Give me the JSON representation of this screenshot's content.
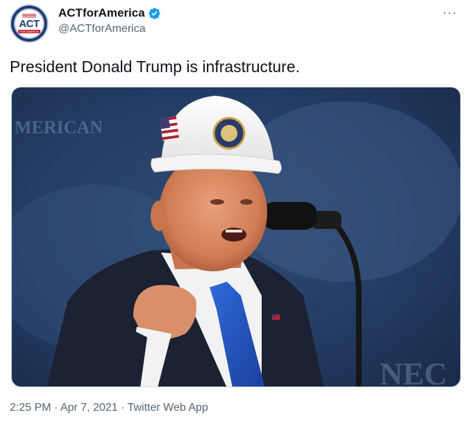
{
  "author": {
    "display_name": "ACTforAmerica",
    "handle": "@ACTforAmerica",
    "verified": true,
    "avatar_text": "ACT",
    "avatar_subtext": "FOR AMERICA"
  },
  "tweet": {
    "text": "President Donald Trump is infrastructure.",
    "time": "2:25 PM",
    "separator": "·",
    "date": "Apr 7, 2021",
    "source": "Twitter Web App"
  },
  "menu": {
    "more_label": "···"
  },
  "media": {
    "description_icon": "photo",
    "background_text_left": "MERICAN",
    "background_text_right": "NEC"
  },
  "colors": {
    "verified_blue": "#1d9bf0",
    "secondary_text": "#536471",
    "primary_text": "#0f1419"
  }
}
